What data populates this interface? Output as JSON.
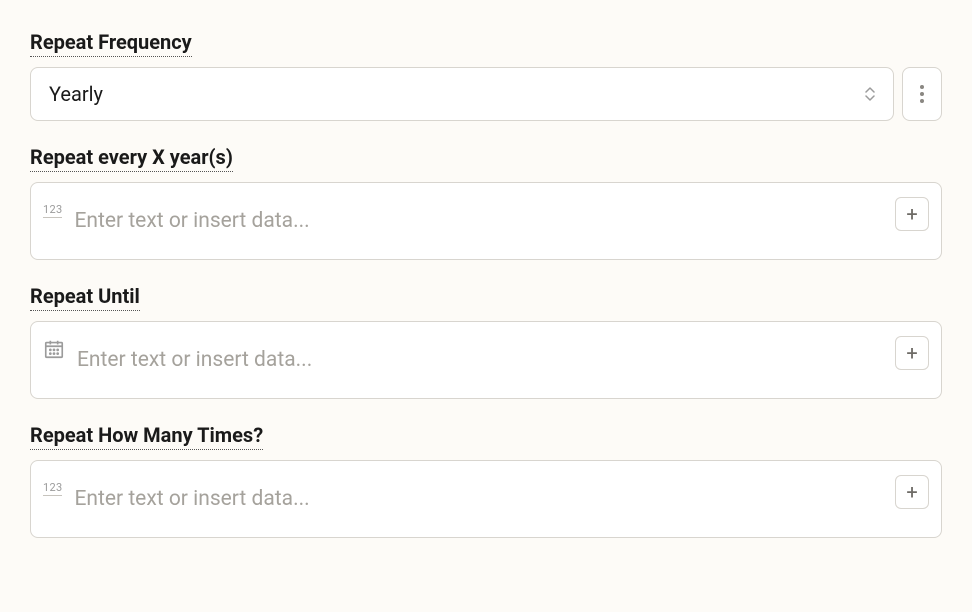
{
  "fields": {
    "frequency": {
      "label": "Repeat Frequency",
      "value": "Yearly"
    },
    "everyX": {
      "label": "Repeat every X year(s)",
      "typeBadge": "123",
      "placeholder": "Enter text or insert data..."
    },
    "until": {
      "label": "Repeat Until",
      "placeholder": "Enter text or insert data..."
    },
    "howMany": {
      "label": "Repeat How Many Times?",
      "typeBadge": "123",
      "placeholder": "Enter text or insert data..."
    }
  }
}
